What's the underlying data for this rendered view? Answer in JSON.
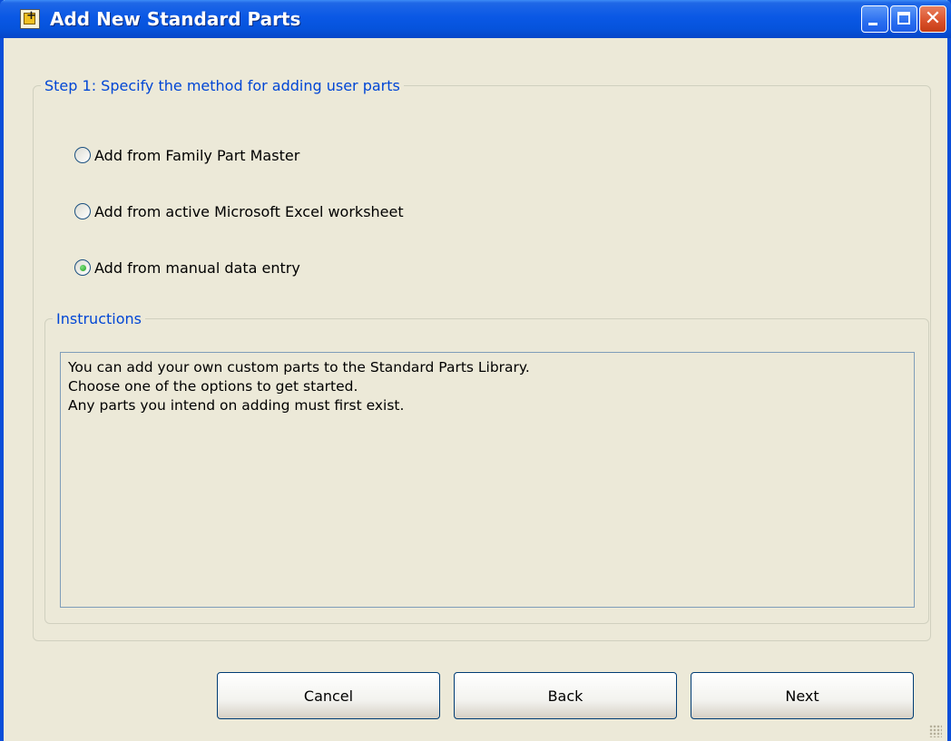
{
  "window": {
    "title": "Add New Standard Parts",
    "icon": "add-part-icon"
  },
  "title_buttons": {
    "minimize_icon": "minimize-icon",
    "maximize_icon": "maximize-icon",
    "close_icon": "close-icon",
    "close_glyph": "✕"
  },
  "step": {
    "legend": "Step 1: Specify the method for adding user parts",
    "options": [
      {
        "label": "Add from Family Part Master",
        "checked": false
      },
      {
        "label": "Add from active Microsoft Excel worksheet",
        "checked": false
      },
      {
        "label": "Add from manual data entry",
        "checked": true
      }
    ]
  },
  "instructions": {
    "legend": "Instructions",
    "lines": [
      "You can add your own custom parts to the Standard Parts Library.",
      "Choose one of the options to get started.",
      "Any parts you intend on adding must first exist."
    ]
  },
  "buttons": {
    "cancel": "Cancel",
    "back": "Back",
    "next": "Next"
  },
  "colors": {
    "titlebar": "#0a58e5",
    "legend_text": "#0046d5",
    "window_bg": "#ece9d8",
    "radio_dot": "#21a121"
  }
}
